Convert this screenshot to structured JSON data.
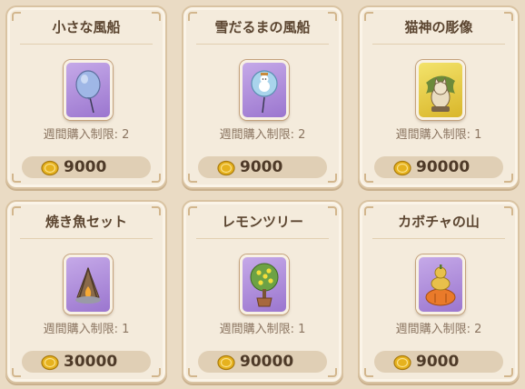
{
  "shop": {
    "items": [
      {
        "name": "小さな風船",
        "limit": "週間購入制限: 2",
        "price": "9000",
        "icon": "blue-balloon-icon",
        "frame_color": "#b593de"
      },
      {
        "name": "雪だるまの風船",
        "limit": "週間購入制限: 2",
        "price": "9000",
        "icon": "snowman-balloon-icon",
        "frame_color": "#b593de"
      },
      {
        "name": "猫神の彫像",
        "limit": "週間購入制限: 1",
        "price": "90000",
        "icon": "cat-god-statue-icon",
        "frame_color": "#e8cc45"
      },
      {
        "name": "焼き魚セット",
        "limit": "週間購入制限: 1",
        "price": "30000",
        "icon": "grilled-fish-campfire-icon",
        "frame_color": "#b593de"
      },
      {
        "name": "レモンツリー",
        "limit": "週間購入制限: 1",
        "price": "90000",
        "icon": "lemon-tree-icon",
        "frame_color": "#b593de"
      },
      {
        "name": "カボチャの山",
        "limit": "週間購入制限: 2",
        "price": "9000",
        "icon": "pumpkin-pile-icon",
        "frame_color": "#b593de"
      }
    ],
    "currency_icon": "gold-coin-icon"
  }
}
